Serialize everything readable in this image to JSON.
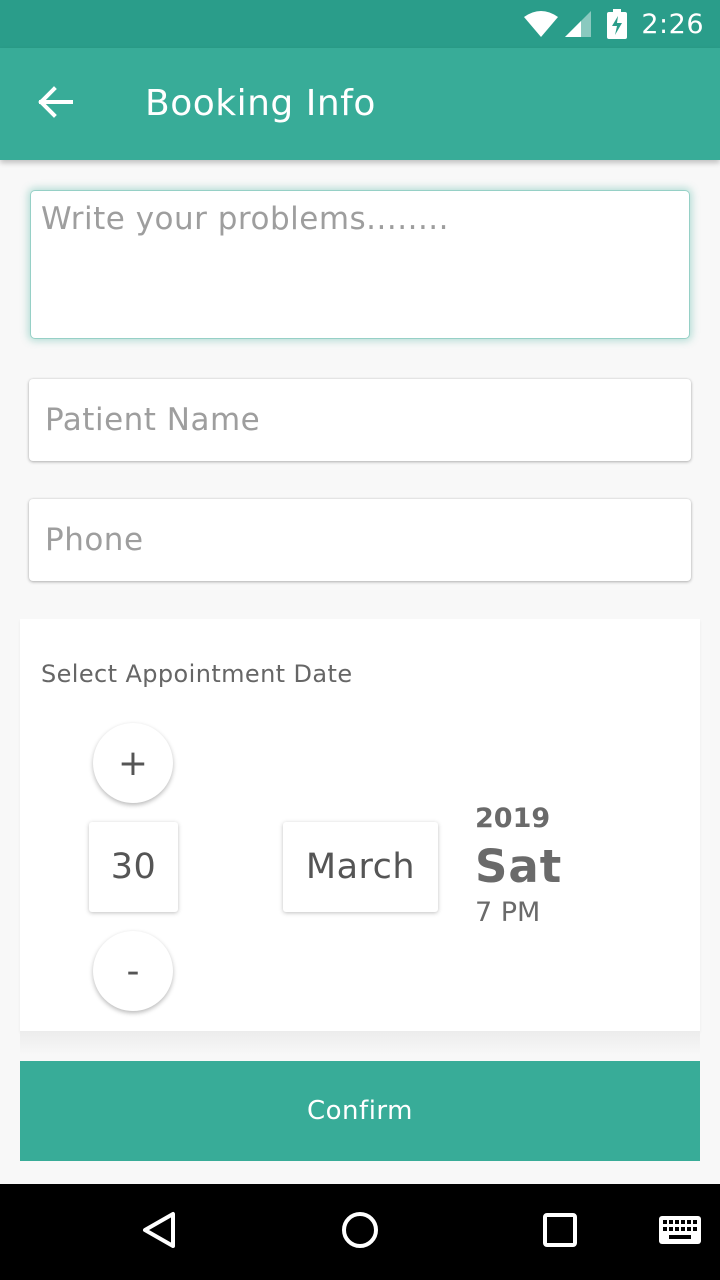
{
  "status_bar": {
    "time": "2:26",
    "icons": [
      "wifi-icon",
      "cell-signal-icon",
      "battery-charging-icon"
    ]
  },
  "app_bar": {
    "title": "Booking Info",
    "back_icon": "arrow-back-icon"
  },
  "form": {
    "problems_placeholder": "Write your problems........",
    "patient_name_placeholder": "Patient Name",
    "phone_placeholder": "Phone"
  },
  "appointment": {
    "title": "Select Appointment Date",
    "increment_label": "+",
    "decrement_label": "-",
    "day": "30",
    "month": "March",
    "year": "2019",
    "weekday": "Sat",
    "time": "7 PM"
  },
  "confirm_label": "Confirm",
  "nav_bar": {
    "icons": [
      "back-triangle-icon",
      "home-circle-icon",
      "recents-square-icon",
      "keyboard-icon"
    ]
  },
  "colors": {
    "primary": "#38ac98",
    "primary_dark": "#2a9d8a",
    "accent_text": "#ffffff"
  }
}
